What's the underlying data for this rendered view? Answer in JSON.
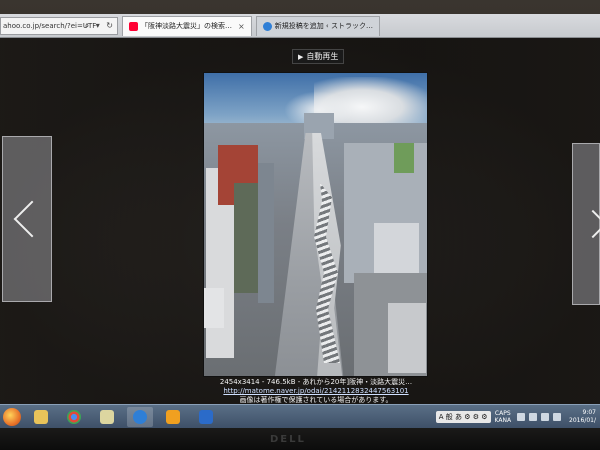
{
  "browser": {
    "address_text": "ahoo.co.jp/search/?ei=UTF-",
    "address_icons": "⌕ ▾ ↻",
    "tabs": [
      {
        "label": "「阪神淡路大震災」の検索…",
        "icon": "yahoo-icon",
        "active": true
      },
      {
        "label": "新規投稿を追加 ‹ ストラック…",
        "icon": "ie-icon",
        "active": false
      }
    ],
    "tab_close": "×"
  },
  "viewer": {
    "slideshow_label": "自動再生",
    "slideshow_icon": "▶",
    "prev_icon": "chevron-left-icon",
    "next_icon": "chevron-right-icon"
  },
  "caption": {
    "line1": "2454x3414 - 746.5kB - あれから20年]阪神・淡路大震災…",
    "link": "http://matome.naver.jp/odai/2142112832447563101",
    "notice": "画像は著作権で保護されている場合があります。"
  },
  "taskbar": {
    "ime_label": "A 般 あ ⚙ ⚙ ⚙",
    "lang_top": "CAPS",
    "lang_bottom": "KANA",
    "time": "9:07",
    "date": "2016/01/"
  },
  "colors": {
    "accent": "#3e5068",
    "overlay": "#2a2724"
  }
}
